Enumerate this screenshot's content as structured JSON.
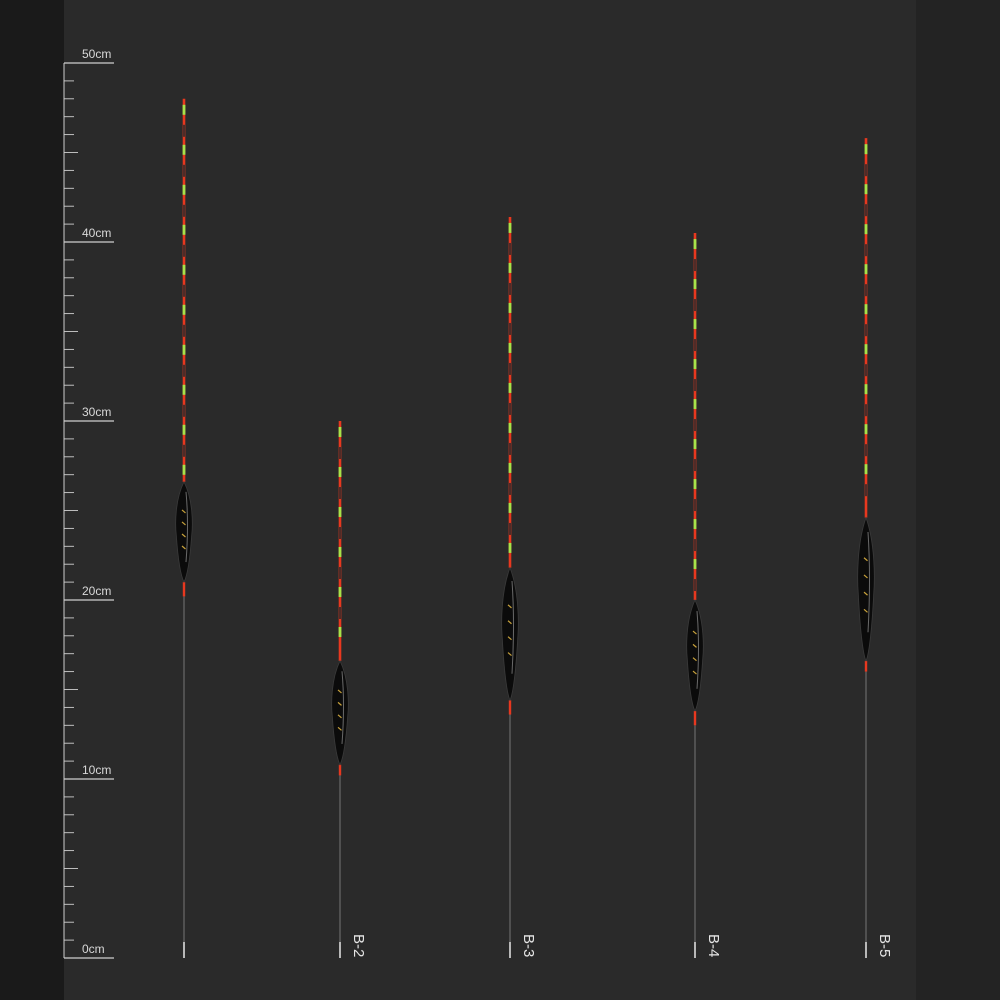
{
  "ruler": {
    "tick_labels": [
      "0cm",
      "10cm",
      "20cm",
      "30cm",
      "40cm",
      "50cm"
    ],
    "range_cm": [
      0,
      50
    ],
    "minor_step_cm": 1
  },
  "floats": [
    {
      "label": "",
      "tip_cm": 48.0,
      "body_top_cm": 26.6,
      "body_bottom_cm": 21.0,
      "foot_cm": 20.2
    },
    {
      "label": "B-2",
      "tip_cm": 30.0,
      "body_top_cm": 16.6,
      "body_bottom_cm": 10.8,
      "foot_cm": 10.2
    },
    {
      "label": "B-3",
      "tip_cm": 41.4,
      "body_top_cm": 21.8,
      "body_bottom_cm": 14.4,
      "foot_cm": 13.6
    },
    {
      "label": "B-4",
      "tip_cm": 40.5,
      "body_top_cm": 20.0,
      "body_bottom_cm": 13.8,
      "foot_cm": 13.0
    },
    {
      "label": "B-5",
      "tip_cm": 45.8,
      "body_top_cm": 24.6,
      "body_bottom_cm": 16.6,
      "foot_cm": 16.0
    }
  ],
  "colors": {
    "background": "#2a2a2a",
    "tip_red": "#e8381f",
    "tip_green": "#a6e34a",
    "body_black": "#0b0b0b",
    "ruler": "#cfcfcf"
  }
}
